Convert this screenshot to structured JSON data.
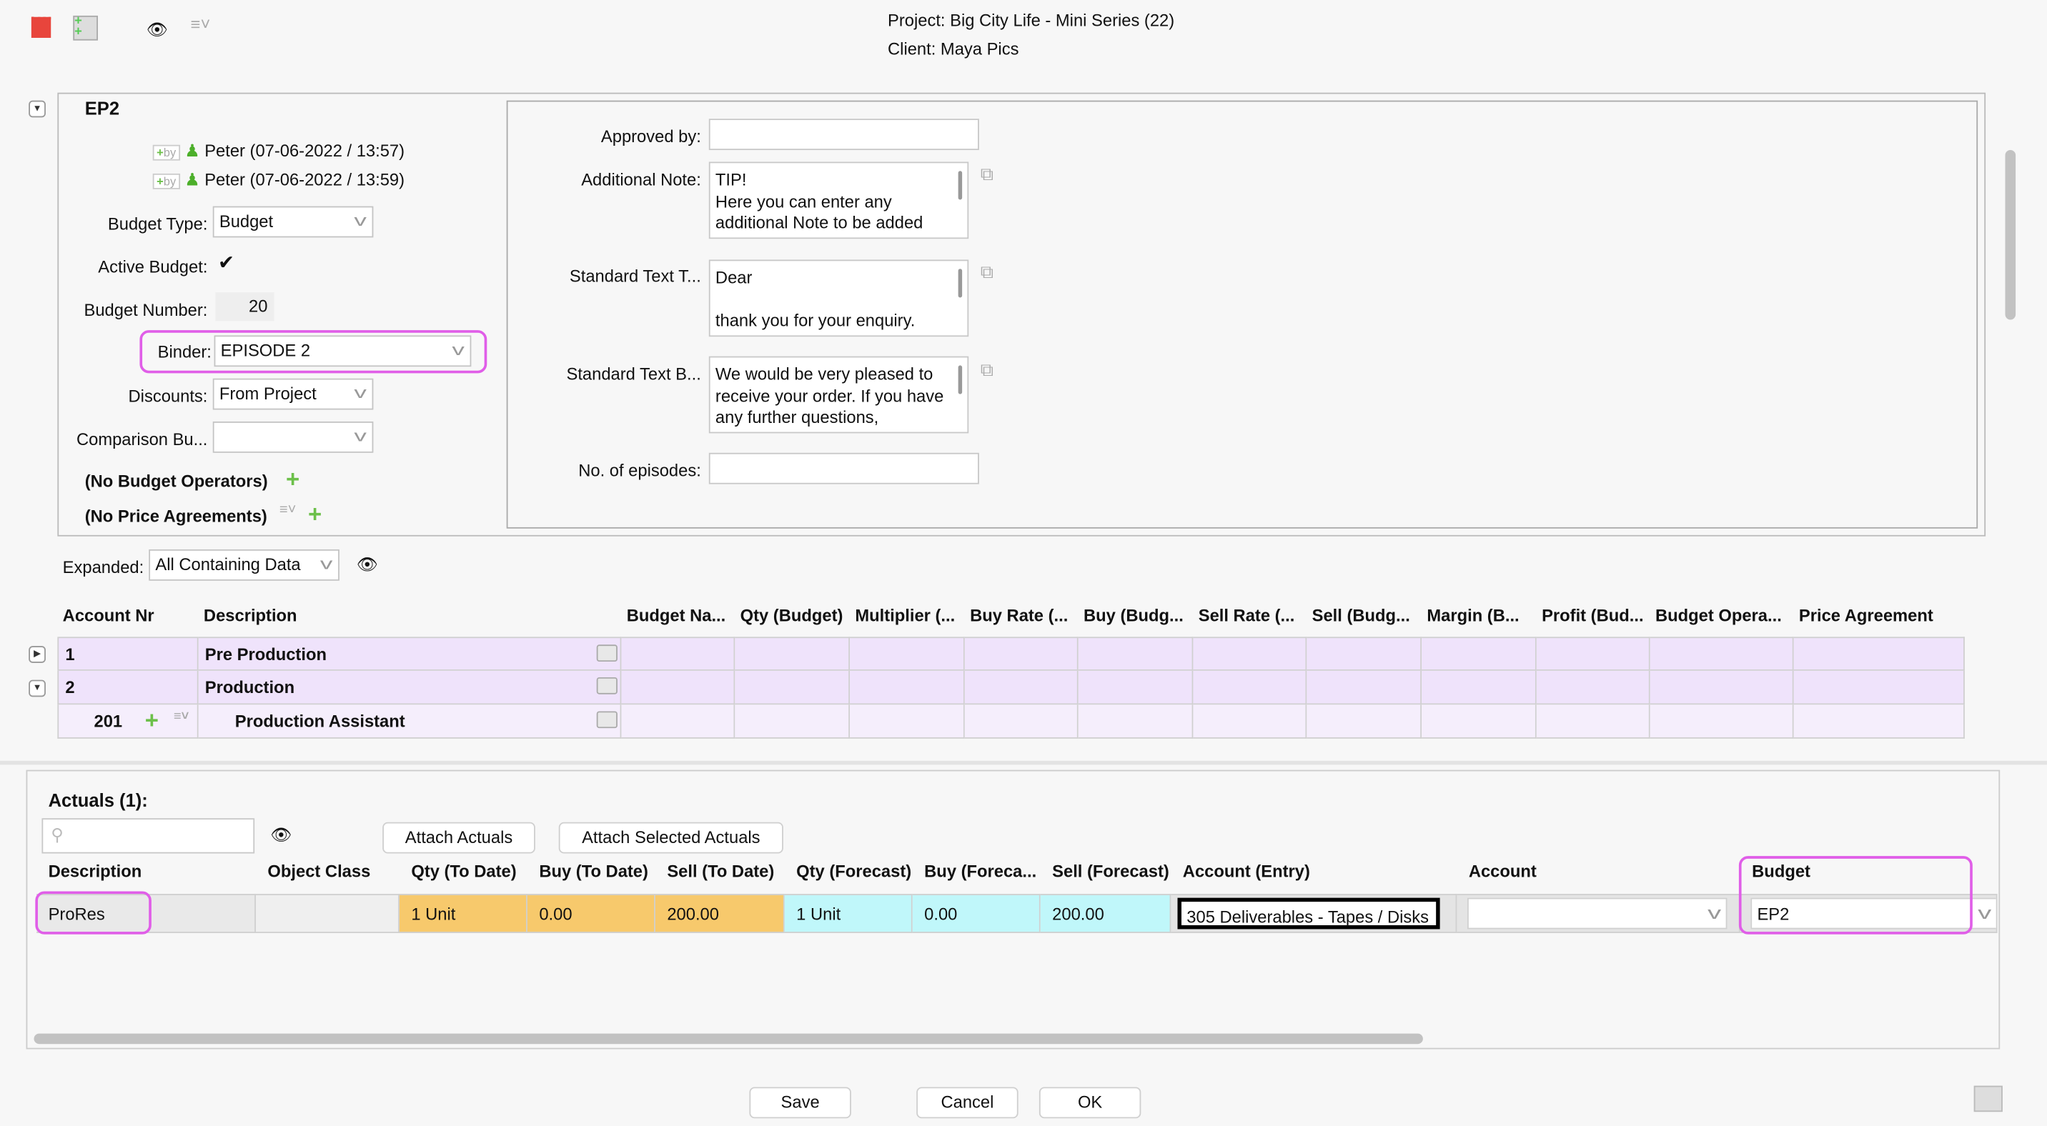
{
  "header": {
    "project": "Project: Big City Life - Mini Series (22)",
    "client": "Client: Maya Pics"
  },
  "toolbar": {
    "icons": [
      "calendar-icon",
      "add-tree-icon",
      "eye-icon",
      "list-menu-icon"
    ]
  },
  "budget": {
    "name": "EP2",
    "history": [
      {
        "by": "by",
        "text": "Peter (07-06-2022 / 13:57)"
      },
      {
        "by": "by",
        "text": "Peter (07-06-2022 / 13:59)"
      }
    ],
    "budget_type_label": "Budget Type:",
    "budget_type": "Budget",
    "active_label": "Active Budget:",
    "active": true,
    "number_label": "Budget Number:",
    "number": "20",
    "binder_label": "Binder:",
    "binder": "EPISODE 2",
    "discounts_label": "Discounts:",
    "discounts": "From Project",
    "comparison_label": "Comparison Bu...",
    "comparison": "",
    "operators": "(No Budget Operators)",
    "agreements": "(No Price Agreements)",
    "approved_label": "Approved by:",
    "approved": "",
    "note_label": "Additional Note:",
    "note": "TIP!\nHere you can enter any additional Note to be added",
    "std_top_label": "Standard Text T...",
    "std_top": "Dear\n\nthank you for your enquiry.",
    "std_bottom_label": "Standard Text B...",
    "std_bottom": "We would be very pleased to receive your order. If you have any further questions,",
    "episodes_label": "No. of episodes:",
    "episodes": ""
  },
  "expanded": {
    "label": "Expanded:",
    "value": "All Containing Data"
  },
  "accounts": {
    "columns": [
      "Account Nr",
      "Description",
      "Budget Na...",
      "Qty (Budget)",
      "Multiplier (...",
      "Buy Rate (...",
      "Buy (Budg...",
      "Sell Rate (...",
      "Sell (Budg...",
      "Margin (B...",
      "Profit (Bud...",
      "Budget Opera...",
      "Price Agreement"
    ],
    "rows": [
      {
        "nr": "1",
        "desc": "Pre Production",
        "expander": "collapsed",
        "color": "#efe3fb"
      },
      {
        "nr": "2",
        "desc": "Production",
        "expander": "expanded",
        "color": "#efe3fb"
      },
      {
        "nr": "201",
        "desc": "Production Assistant",
        "expander": "",
        "color": "#f5eefc"
      }
    ]
  },
  "actuals": {
    "title": "Actuals (1):",
    "search_placeholder": "",
    "attach": "Attach Actuals",
    "attach_selected": "Attach Selected Actuals",
    "columns": [
      "Description",
      "Object Class",
      "Qty (To Date)",
      "Buy (To Date)",
      "Sell (To Date)",
      "Qty (Forecast)",
      "Buy (Foreca...",
      "Sell (Forecast)",
      "Account (Entry)",
      "Account",
      "Budget"
    ],
    "rows": [
      [
        "ProRes",
        "",
        "1 Unit",
        "0.00",
        "200.00",
        "1 Unit",
        "0.00",
        "200.00",
        "305 Deliverables - Tapes / Disks",
        "",
        "EP2"
      ]
    ],
    "colors": {
      "to_date": "#f7c96c",
      "forecast": "#c0f7fa",
      "highlight": "#e05ee8"
    }
  },
  "footer": {
    "save": "Save",
    "cancel": "Cancel",
    "ok": "OK"
  }
}
